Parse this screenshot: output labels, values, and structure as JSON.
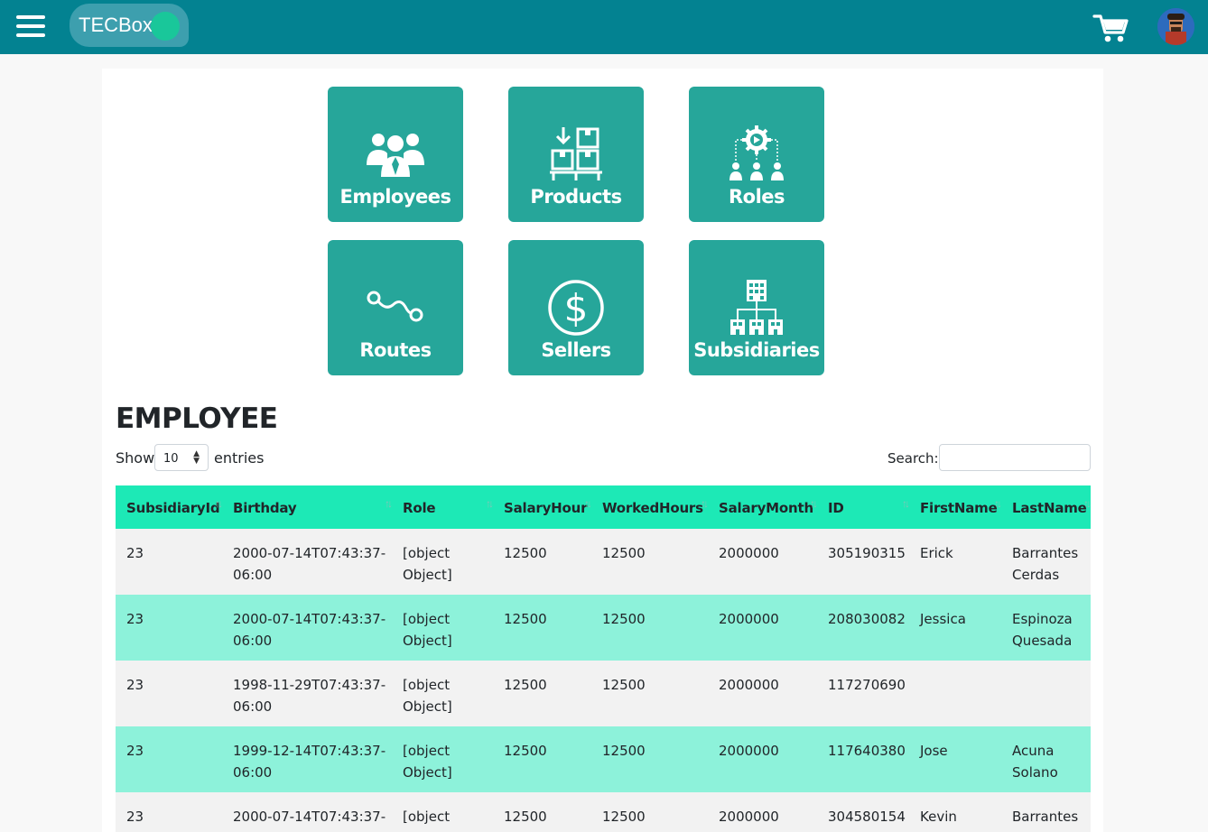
{
  "header": {
    "menu_icon": "hamburger-menu-icon",
    "logo_text": "TECBox",
    "logo_badge_icon": "check-circle-icon",
    "cart_icon": "shopping-cart-icon",
    "avatar_icon": "user-avatar"
  },
  "tiles": [
    {
      "label": "Employees",
      "icon": "employees-group-icon"
    },
    {
      "label": "Products",
      "icon": "products-boxes-icon"
    },
    {
      "label": "Roles",
      "icon": "roles-hierarchy-icon"
    },
    {
      "label": "Routes",
      "icon": "route-path-icon"
    },
    {
      "label": "Sellers",
      "icon": "dollar-circle-icon"
    },
    {
      "label": "Subsidiaries",
      "icon": "buildings-network-icon"
    }
  ],
  "section": {
    "title": "EMPLOYEE"
  },
  "controls": {
    "show_label": "Show",
    "page_length": "10",
    "entries_label": "entries",
    "search_label": "Search:",
    "search_value": ""
  },
  "table": {
    "columns": [
      "SubsidiaryId",
      "Birthday",
      "Role",
      "SalaryHour",
      "WorkedHours",
      "SalaryMonth",
      "ID",
      "FirstName",
      "LastName"
    ],
    "rows": [
      {
        "SubsidiaryId": "23",
        "Birthday_1": "2000-07-14T07:43:37-",
        "Birthday_2": "06:00",
        "Role_1": "[object",
        "Role_2": "Object]",
        "SalaryHour": "12500",
        "WorkedHours": "12500",
        "SalaryMonth": "2000000",
        "ID": "305190315",
        "FirstName": "Erick",
        "LastName_1": "Barrantes",
        "LastName_2": "Cerdas"
      },
      {
        "SubsidiaryId": "23",
        "Birthday_1": "2000-07-14T07:43:37-",
        "Birthday_2": "06:00",
        "Role_1": "[object",
        "Role_2": "Object]",
        "SalaryHour": "12500",
        "WorkedHours": "12500",
        "SalaryMonth": "2000000",
        "ID": "208030082",
        "FirstName": "Jessica",
        "LastName_1": "Espinoza",
        "LastName_2": "Quesada"
      },
      {
        "SubsidiaryId": "23",
        "Birthday_1": "1998-11-29T07:43:37-",
        "Birthday_2": "06:00",
        "Role_1": "[object",
        "Role_2": "Object]",
        "SalaryHour": "12500",
        "WorkedHours": "12500",
        "SalaryMonth": "2000000",
        "ID": "117270690",
        "FirstName": "",
        "LastName_1": "",
        "LastName_2": ""
      },
      {
        "SubsidiaryId": "23",
        "Birthday_1": "1999-12-14T07:43:37-",
        "Birthday_2": "06:00",
        "Role_1": "[object",
        "Role_2": "Object]",
        "SalaryHour": "12500",
        "WorkedHours": "12500",
        "SalaryMonth": "2000000",
        "ID": "117640380",
        "FirstName": "Jose",
        "LastName_1": "Acuna",
        "LastName_2": "Solano"
      },
      {
        "SubsidiaryId": "23",
        "Birthday_1": "2000-07-14T07:43:37-",
        "Birthday_2": "",
        "Role_1": "[object",
        "Role_2": "",
        "SalaryHour": "12500",
        "WorkedHours": "12500",
        "SalaryMonth": "2000000",
        "ID": "304580154",
        "FirstName": "Kevin",
        "LastName_1": "Barrantes",
        "LastName_2": ""
      }
    ]
  },
  "colors": {
    "topbar": "#038291",
    "tile": "#26a69a",
    "table_header": "#1de9b6",
    "row_even": "#f2f2f2",
    "row_odd": "#8df2da"
  }
}
